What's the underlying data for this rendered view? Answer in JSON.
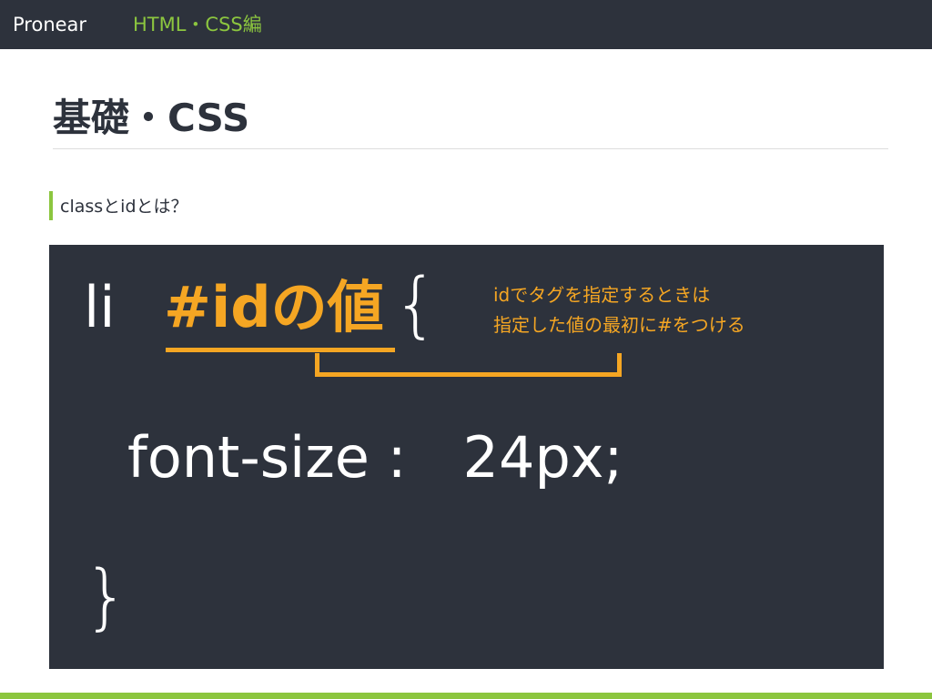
{
  "header": {
    "brand": "Pronear",
    "section": "HTML・CSS編"
  },
  "page": {
    "title": "基礎・CSS",
    "subheading": "classとidとは？"
  },
  "code": {
    "selector": "li",
    "id_value": "#idの値",
    "open_brace": "{",
    "declaration": "font-size :　24px;",
    "close_brace": "}"
  },
  "annotation": {
    "line1": "idでタグを指定するときは",
    "line2": "指定した値の最初に#をつける"
  },
  "colors": {
    "dark": "#2d323c",
    "accent_green": "#8cc63f",
    "accent_orange": "#f5a623"
  }
}
